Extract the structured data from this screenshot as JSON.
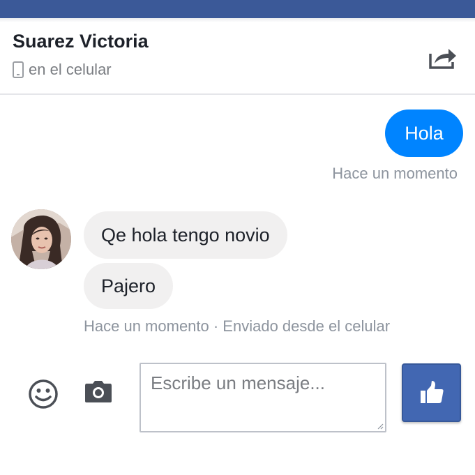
{
  "header": {
    "contact_name": "Suarez Victoria",
    "status": "en el celular",
    "share_icon": "share-icon",
    "phone_icon": "phone-icon"
  },
  "messages": {
    "sent": [
      {
        "text": "Hola"
      }
    ],
    "sent_timestamp": "Hace un momento",
    "received": [
      {
        "text": "Qe hola tengo novio"
      },
      {
        "text": "Pajero"
      }
    ],
    "received_meta": "Hace un momento · Enviado desde el celular"
  },
  "composer": {
    "placeholder": "Escribe un mensaje...",
    "emoji_icon": "emoji-icon",
    "camera_icon": "camera-icon",
    "like_icon": "thumbs-up-icon"
  },
  "colors": {
    "brand_bar": "#3b5998",
    "sent_bubble": "#0084ff",
    "received_bubble": "#f1f0f0",
    "like_button": "#4267b2"
  }
}
